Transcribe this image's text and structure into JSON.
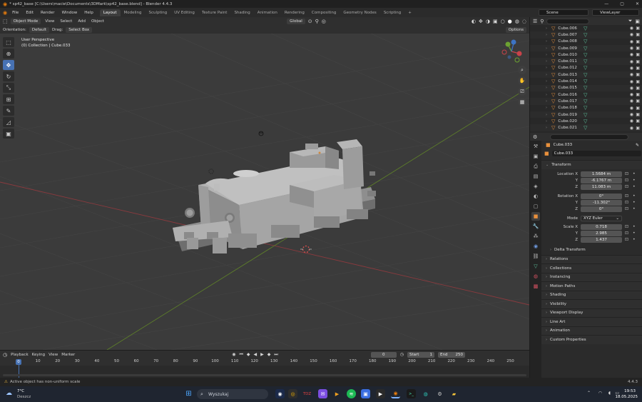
{
  "window": {
    "title": "* sp42_base [C:\\Users\\macie\\Documents\\3DMark\\sp42_base.blend] - Blender 4.4.3"
  },
  "menu": [
    "File",
    "Edit",
    "Render",
    "Window",
    "Help"
  ],
  "workspaces": [
    "Layout",
    "Modeling",
    "Sculpting",
    "UV Editing",
    "Texture Paint",
    "Shading",
    "Animation",
    "Rendering",
    "Compositing",
    "Geometry Nodes",
    "Scripting",
    "+"
  ],
  "scene": {
    "scene_name": "Scene",
    "view_layer": "ViewLayer"
  },
  "viewport": {
    "mode": "Object Mode",
    "menus": [
      "View",
      "Select",
      "Add",
      "Object"
    ],
    "orientation_label": "Orientation:",
    "orientation_value": "Default",
    "drag_label": "Drag:",
    "drag_value": "Select Box",
    "transform_orientation": "Global",
    "options": "Options",
    "info_line1": "User Perspective",
    "info_line2": "(0) Collection | Cube.033"
  },
  "outliner": {
    "search_placeholder": "",
    "items": [
      "Cube.006",
      "Cube.007",
      "Cube.008",
      "Cube.009",
      "Cube.010",
      "Cube.011",
      "Cube.012",
      "Cube.013",
      "Cube.014",
      "Cube.015",
      "Cube.016",
      "Cube.017",
      "Cube.018",
      "Cube.019",
      "Cube.020",
      "Cube.021"
    ]
  },
  "properties": {
    "object_name": "Cube.033",
    "data_name": "Cube.033",
    "transform_label": "Transform",
    "location_label": "Location X",
    "location": [
      "1.5684 m",
      "-6.1767 m",
      "11.083 m"
    ],
    "rotation_label": "Rotation X",
    "rotation": [
      "0°",
      "-11.302°",
      "0°"
    ],
    "mode_label": "Mode",
    "mode_value": "XYZ Euler",
    "scale_label": "Scale X",
    "scale": [
      "0.718",
      "2.985",
      "1.437"
    ],
    "axis_y": "Y",
    "axis_z": "Z",
    "delta_transform": "Delta Transform",
    "sections": [
      "Relations",
      "Collections",
      "Instancing",
      "Motion Paths",
      "Shading",
      "Visibility",
      "Viewport Display",
      "Line Art",
      "Animation",
      "Custom Properties"
    ]
  },
  "timeline": {
    "menus": [
      "Playback",
      "Keying",
      "View",
      "Marker"
    ],
    "current_frame": "0",
    "start_label": "Start",
    "start": "1",
    "end_label": "End",
    "end": "250",
    "ticks": [
      "0",
      "10",
      "20",
      "30",
      "40",
      "50",
      "60",
      "70",
      "80",
      "90",
      "100",
      "110",
      "120",
      "130",
      "140",
      "150",
      "160",
      "170",
      "180",
      "190",
      "200",
      "210",
      "220",
      "230",
      "240",
      "250"
    ]
  },
  "status": {
    "message": "Active object has non-uniform scale",
    "version": "4.4.3"
  },
  "taskbar": {
    "weather_temp": "7°C",
    "weather_desc": "Deszcz",
    "search": "Wyszukaj",
    "time": "19:53",
    "date": "18.05.2025",
    "badge": "TDZ"
  },
  "colors": {
    "accent": "#4772b3",
    "object_orange": "#e8903c",
    "mesh_green": "#5ec7a0",
    "x_axis": "#b8383f",
    "y_axis": "#6b9a2e"
  }
}
